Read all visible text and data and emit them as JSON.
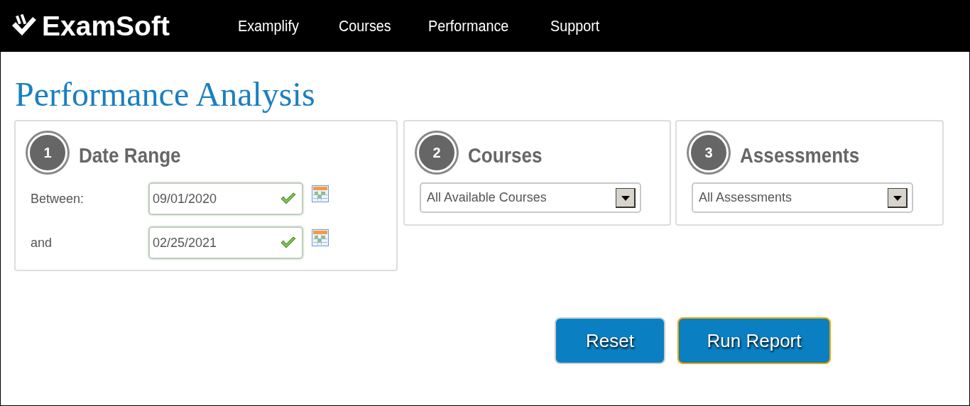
{
  "header": {
    "logo": "ExamSoft",
    "nav": [
      {
        "label": "Examplify"
      },
      {
        "label": "Courses"
      },
      {
        "label": "Performance"
      },
      {
        "label": "Support"
      }
    ]
  },
  "page_title": "Performance Analysis",
  "panels": [
    {
      "kind": "dates",
      "step": "1",
      "title": "Date Range",
      "fields": [
        {
          "label": "Between:",
          "value": "09/01/2020",
          "valid": true
        },
        {
          "label": "and",
          "value": "02/25/2021",
          "valid": true
        }
      ]
    },
    {
      "kind": "select",
      "step": "2",
      "title": "Courses",
      "value": "All Available Courses"
    },
    {
      "kind": "select",
      "step": "3",
      "title": "Assessments",
      "value": "All Assessments"
    }
  ],
  "buttons": [
    {
      "label": "Reset",
      "focused": false
    },
    {
      "label": "Run Report",
      "focused": true
    }
  ]
}
